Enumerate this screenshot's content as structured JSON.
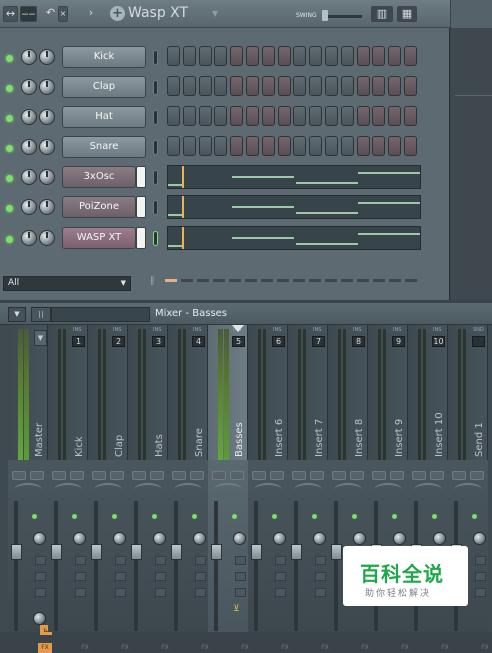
{
  "channel_rack": {
    "title": "Wasp XT",
    "swing_label": "SWING",
    "filter": "All",
    "channels": [
      {
        "name": "Kick",
        "kind": "steps",
        "steps": [
          0,
          0,
          0,
          0,
          1,
          1,
          1,
          1,
          0,
          0,
          0,
          0,
          1,
          1,
          1,
          1
        ]
      },
      {
        "name": "Clap",
        "kind": "steps",
        "steps": [
          0,
          0,
          0,
          0,
          1,
          1,
          1,
          1,
          0,
          0,
          0,
          0,
          1,
          1,
          1,
          1
        ]
      },
      {
        "name": "Hat",
        "kind": "steps",
        "steps": [
          0,
          0,
          0,
          0,
          1,
          1,
          1,
          1,
          0,
          0,
          0,
          0,
          1,
          1,
          1,
          1
        ]
      },
      {
        "name": "Snare",
        "kind": "steps",
        "steps": [
          0,
          0,
          0,
          0,
          1,
          1,
          1,
          1,
          0,
          0,
          0,
          0,
          1,
          1,
          1,
          1
        ]
      },
      {
        "name": "3xOsc",
        "kind": "roll"
      },
      {
        "name": "PoiZone",
        "kind": "roll"
      },
      {
        "name": "WASP XT",
        "kind": "roll",
        "selected": true
      }
    ]
  },
  "mixer": {
    "title": "Mixer - Basses",
    "insert_label": "INS",
    "send_label": "SND",
    "fx_label": "FX",
    "tracks": [
      {
        "name": "Master",
        "num": ""
      },
      {
        "name": "Kick",
        "num": "1"
      },
      {
        "name": "Clap",
        "num": "2"
      },
      {
        "name": "Hats",
        "num": "3"
      },
      {
        "name": "Snare",
        "num": "4"
      },
      {
        "name": "Basses",
        "num": "5",
        "selected": true
      },
      {
        "name": "Insert 6",
        "num": "6"
      },
      {
        "name": "Insert 7",
        "num": "7"
      },
      {
        "name": "Insert 8",
        "num": "8"
      },
      {
        "name": "Insert 9",
        "num": "9"
      },
      {
        "name": "Insert 10",
        "num": "10"
      },
      {
        "name": "Send 1",
        "num": ""
      }
    ]
  },
  "watermark": {
    "title": "百科全说",
    "subtitle": "助你轻松解决"
  },
  "colors": {
    "led": "#7ee06a",
    "accent": "#e39a4a",
    "meter": "#62a83c"
  }
}
